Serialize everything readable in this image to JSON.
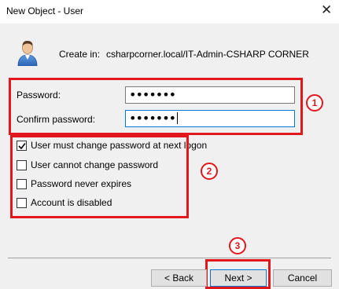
{
  "window": {
    "title": "New Object - User",
    "close_glyph": "✕"
  },
  "header": {
    "icon": "user-icon",
    "create_in_label": "Create in:",
    "create_in_path": "csharpcorner.local/IT-Admin-CSHARP CORNER"
  },
  "form": {
    "password_label": "Password:",
    "password_value": "•••••••",
    "confirm_label": "Confirm password:",
    "confirm_value": "•••••••"
  },
  "options": [
    {
      "label": "User must change password at next logon",
      "checked": true
    },
    {
      "label": "User cannot change password",
      "checked": false
    },
    {
      "label": "Password never expires",
      "checked": false
    },
    {
      "label": "Account is disabled",
      "checked": false
    }
  ],
  "annotations": {
    "badge1": "1",
    "badge2": "2",
    "badge3": "3",
    "color": "#e2171c"
  },
  "buttons": {
    "back": "< Back",
    "next": "Next >",
    "cancel": "Cancel"
  }
}
